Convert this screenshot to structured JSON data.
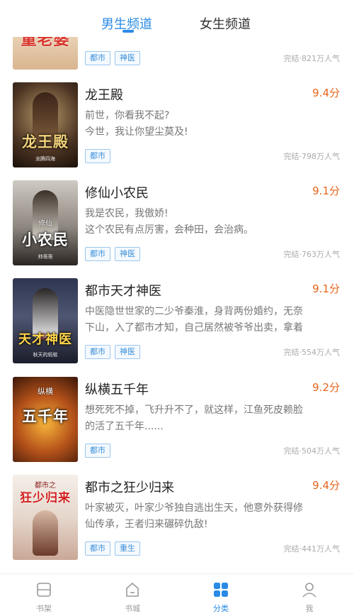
{
  "tabs": {
    "male": "男生频道",
    "female": "女生频道",
    "active": "male"
  },
  "top_partial_book": {
    "cover_text": "童老婆",
    "tags": [
      "都市",
      "神医"
    ],
    "meta": "完结·821万人气"
  },
  "books": [
    {
      "title": "龙王殿",
      "score": "9.4分",
      "desc": [
        "前世，你看我不起?",
        "今世，我让你望尘莫及!"
      ],
      "tags": [
        "都市"
      ],
      "meta": "完结·798万人气",
      "cover_title": "龙王殿",
      "cover_sub": "",
      "cover_author": "龙腾四海"
    },
    {
      "title": "修仙小农民",
      "score": "9.1分",
      "desc": [
        "我是农民，我傲娇!",
        "这个农民有点厉害，会种田，会治病。"
      ],
      "tags": [
        "都市",
        "神医"
      ],
      "meta": "完结·763万人气",
      "cover_title": "小农民",
      "cover_sub": "修仙",
      "cover_author": "帅哥哥"
    },
    {
      "title": "都市天才神医",
      "score": "9.1分",
      "desc": [
        "中医隐世世家的二少爷秦淮，身背两份婚约，无奈",
        "下山，入了都市才知，自己居然被爷爷出卖，拿着"
      ],
      "tags": [
        "都市",
        "神医"
      ],
      "meta": "完结·554万人气",
      "cover_title": "天才神医",
      "cover_sub": "都市",
      "cover_author": "秋天的蚂蚁"
    },
    {
      "title": "纵横五千年",
      "score": "9.2分",
      "desc": [
        "想死死不掉，飞升升不了，就这样，江鱼死皮赖脸",
        "的活了五千年......"
      ],
      "tags": [
        "都市"
      ],
      "meta": "完结·504万人气",
      "cover_title": "五千年",
      "cover_sub": "纵横",
      "cover_author": ""
    },
    {
      "title": "都市之狂少归来",
      "score": "9.4分",
      "desc": [
        "叶家被灭，叶家少爷独自逃出生天，他意外获得修",
        "仙传承，王者归来碾碎仇敌!"
      ],
      "tags": [
        "都市",
        "重生"
      ],
      "meta": "完结·441万人气",
      "cover_title": "狂少归来",
      "cover_sub": "都市之",
      "cover_author": ""
    }
  ],
  "bottom_nav": [
    {
      "label": "书架",
      "icon": "bookshelf-icon"
    },
    {
      "label": "书城",
      "icon": "bookstore-icon"
    },
    {
      "label": "分类",
      "icon": "category-icon"
    },
    {
      "label": "我",
      "icon": "profile-icon"
    }
  ],
  "colors": {
    "accent": "#2a8be6",
    "score": "#e8651d",
    "tag_border": "#9cc6ef"
  }
}
